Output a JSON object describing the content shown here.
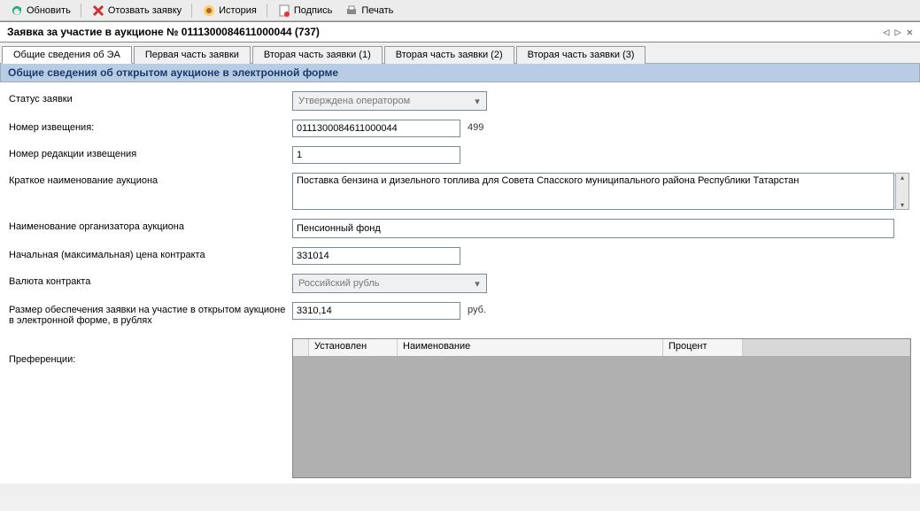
{
  "toolbar": {
    "refresh": "Обновить",
    "withdraw": "Отозвать заявку",
    "history": "История",
    "sign": "Подпись",
    "print": "Печать"
  },
  "window": {
    "title": "Заявка за участие в аукционе № 0111300084611000044 (737)"
  },
  "tabs": [
    {
      "label": "Общие сведения об ЭА",
      "active": true
    },
    {
      "label": "Первая часть заявки",
      "active": false
    },
    {
      "label": "Вторая часть заявки (1)",
      "active": false
    },
    {
      "label": "Вторая часть заявки (2)",
      "active": false
    },
    {
      "label": "Вторая часть заявки (3)",
      "active": false
    }
  ],
  "section_title": "Общие сведения об открытом аукционе в электронной форме",
  "form": {
    "status_label": "Статус заявки",
    "status_value": "Утверждена оператором",
    "notice_num_label": "Номер извещения:",
    "notice_num_value": "0111300084611000044",
    "notice_side": "499",
    "revision_label": "Номер редакции извещения",
    "revision_value": "1",
    "short_name_label": "Краткое наименование аукциона",
    "short_name_value": "Поставка бензина и дизельного топлива для Совета Спасского муниципального района Республики Татарстан",
    "organizer_label": "Наименование организатора аукциона",
    "organizer_value": "Пенсионный фонд",
    "price_label": "Начальная (максимальная) цена контракта",
    "price_value": "331014",
    "currency_label": "Валюта контракта",
    "currency_value": "Российский рубль",
    "deposit_label": "Размер обеспечения заявки на участие в открытом аукционе в электронной форме, в рублях",
    "deposit_value": "3310,14",
    "deposit_unit": "руб."
  },
  "grid": {
    "label": "Преференции:",
    "columns": [
      "Установлен",
      "Наименование",
      "Процент"
    ]
  }
}
